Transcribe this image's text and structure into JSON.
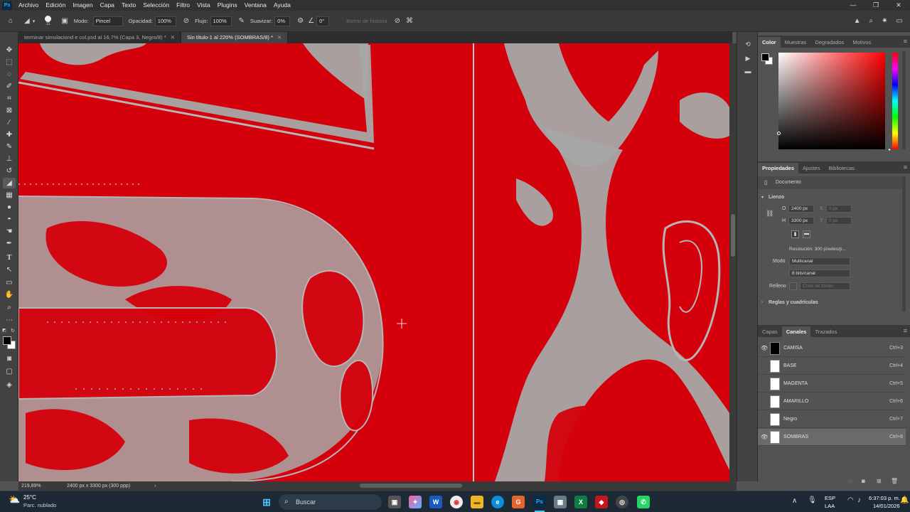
{
  "app": {
    "logo": "Ps",
    "menu": [
      "Archivo",
      "Edición",
      "Imagen",
      "Capa",
      "Texto",
      "Selección",
      "Filtro",
      "Vista",
      "Plugins",
      "Ventana",
      "Ayuda"
    ],
    "window_controls": [
      "—",
      "❐",
      "✕"
    ]
  },
  "options": {
    "brush_size": "31",
    "modo_label": "Modo:",
    "modo_value": "Pincel",
    "opacidad_label": "Opacidad:",
    "opacidad_value": "100%",
    "flujo_label": "Flujo:",
    "flujo_value": "100%",
    "suavizar_label": "Suavizar:",
    "suavizar_value": "0%",
    "angle_value": "0°",
    "borrar_historia": "Borrar de historia"
  },
  "tabs": [
    {
      "label": "terminar simulaciond e col.psd al 16,7% (Capa 3, Negro/8) *",
      "close": "✕"
    },
    {
      "label": "Sin título-1 al 220% (SOMBRAS/8) *",
      "close": "✕"
    }
  ],
  "status": {
    "zoom": "219,89%",
    "doc_size": "2400 px x 3300 px (300 ppp)",
    "arrow": "›"
  },
  "color_panel": {
    "tabs": [
      "Color",
      "Muestras",
      "Degradados",
      "Motivos"
    ],
    "active": "Color",
    "hue_color": "#ff0000"
  },
  "properties": {
    "tabs": [
      "Propiedades",
      "Ajustes",
      "Bibliotecas"
    ],
    "doc_label": "Documento",
    "lienzo": "Lienzo",
    "w_label": "O",
    "w_value": "2400 px",
    "x_label": "X",
    "x_value": "0 px",
    "h_label": "H",
    "h_value": "3300 px",
    "y_label": "Y",
    "y_value": "0 px",
    "resolucion": "Resolución: 300 píxeles/p...",
    "modo_label": "Modo",
    "modo_value": "Multicanal",
    "bits_value": "8 bits/canal",
    "relleno_label": "Relleno",
    "relleno_value": "Color de fondo",
    "reglas": "Reglas y cuadrículas"
  },
  "channels": {
    "tabs": [
      "Capas",
      "Canales",
      "Trazados"
    ],
    "active": "Canales",
    "rows": [
      {
        "name": "CAMISA",
        "key": "Ctrl+3",
        "eye": true,
        "thumb": "black",
        "selected": false
      },
      {
        "name": "BASE",
        "key": "Ctrl+4",
        "eye": false,
        "thumb": "white",
        "selected": false
      },
      {
        "name": "MAGENTA",
        "key": "Ctrl+5",
        "eye": false,
        "thumb": "white",
        "selected": false
      },
      {
        "name": "AMARILLO",
        "key": "Ctrl+6",
        "eye": false,
        "thumb": "white",
        "selected": false
      },
      {
        "name": "Negro",
        "key": "Ctrl+7",
        "eye": false,
        "thumb": "white",
        "selected": false
      },
      {
        "name": "SOMBRAS",
        "key": "Ctrl+8",
        "eye": true,
        "thumb": "white",
        "selected": true
      }
    ]
  },
  "taskbar": {
    "weather_temp": "25°C",
    "weather_desc": "Parc. nublado",
    "search": "Buscar",
    "lang1": "ESP",
    "lang2": "LAA",
    "time": "6:37:03 p. m.",
    "date": "14/01/2026"
  },
  "colors": {
    "canvas_red": "#d4000b",
    "canvas_gray": "#a8a8a8",
    "accent": "#31a8ff"
  }
}
